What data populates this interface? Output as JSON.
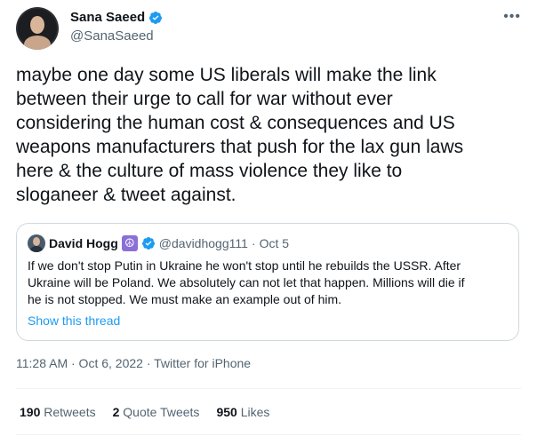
{
  "author": {
    "name": "Sana Saeed",
    "handle": "@SanaSaeed",
    "verified": true
  },
  "more_icon": "more-icon",
  "tweet": {
    "text": "maybe one day some US liberals will make the link\nbetween their urge to call for war without ever\nconsidering the human cost & consequences and US\nweapons manufacturers that push for the lax gun laws\nhere & the culture of mass violence they like to\nsloganeer & tweet against."
  },
  "quoted": {
    "name": "David Hogg",
    "emoji": "☮",
    "handle": "@davidhogg111",
    "separator": "·",
    "date": "Oct 5",
    "text": "If we don't stop Putin in Ukraine he won't stop until he rebuilds the USSR. After\nUkraine will be Poland. We absolutely can not let that happen. Millions will die if\nhe is not stopped. We must make an example out of him.",
    "show_thread": "Show this thread"
  },
  "meta": {
    "timestamp": "11:28 AM · Oct 6, 2022 · Twitter for iPhone"
  },
  "stats": {
    "retweets_count": "190",
    "retweets_label": "Retweets",
    "quotes_count": "2",
    "quotes_label": "Quote Tweets",
    "likes_count": "950",
    "likes_label": "Likes"
  },
  "colors": {
    "accent": "#1d9bf0",
    "secondary_text": "#536471",
    "border": "#cfd9de"
  }
}
